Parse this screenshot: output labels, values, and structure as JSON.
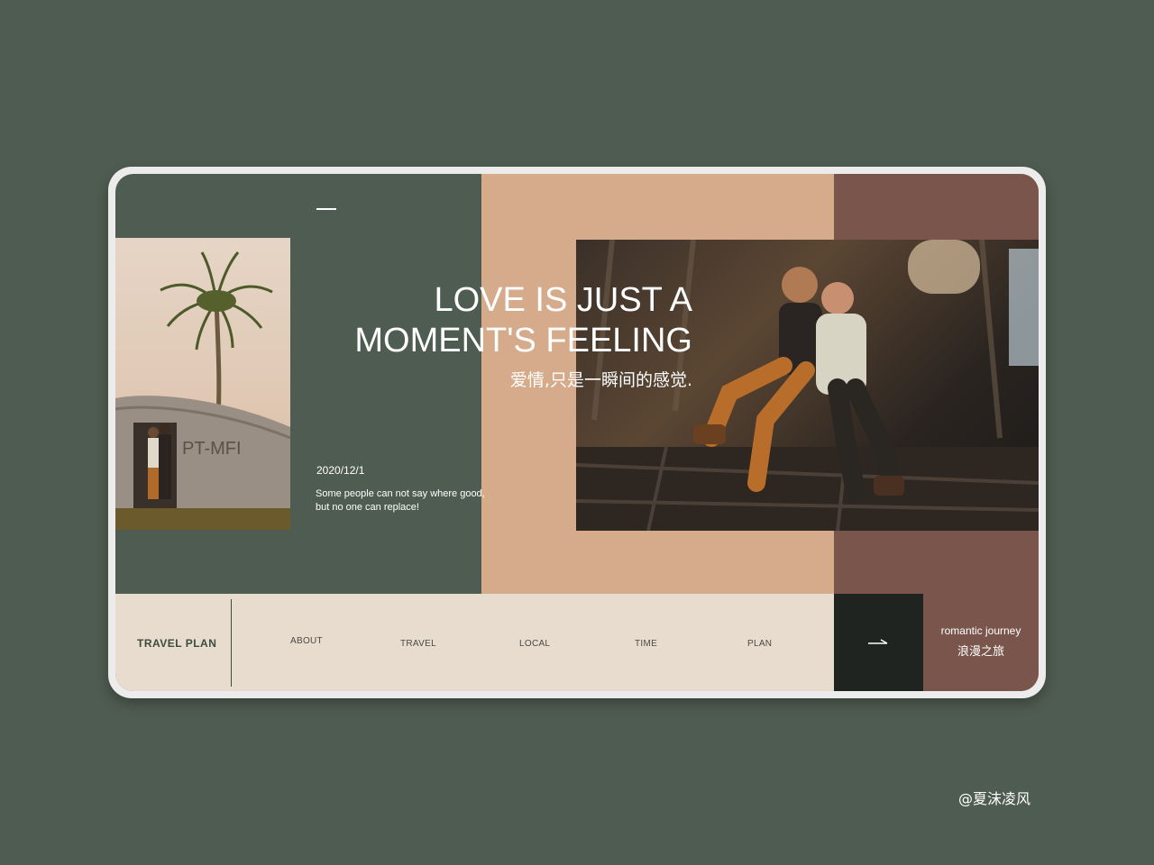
{
  "hero": {
    "headline_line1": "LOVE IS JUST A",
    "headline_line2": "MOMENT'S FEELING",
    "subtitle_cn": "爱情,只是一瞬间的感觉."
  },
  "post": {
    "date": "2020/12/1",
    "blurb": "Some people can not say where good, but no one can replace!"
  },
  "photo_left": {
    "plane_marking": "PT-MFI"
  },
  "bottom_bar": {
    "brand": "TRAVEL PLAN",
    "nav": [
      "ABOUT",
      "TRAVEL",
      "LOCAL",
      "TIME",
      "PLAN"
    ]
  },
  "romantic": {
    "en": "romantic journey",
    "cn": "浪漫之旅"
  },
  "watermark": "@夏沫凌风",
  "colors": {
    "background": "#4f5c51",
    "peach": "#d5ab8b",
    "brown": "#7a554c",
    "cream": "#e7dccd",
    "dark": "#202421"
  },
  "icons": {
    "arrow": "arrow-right-icon"
  }
}
